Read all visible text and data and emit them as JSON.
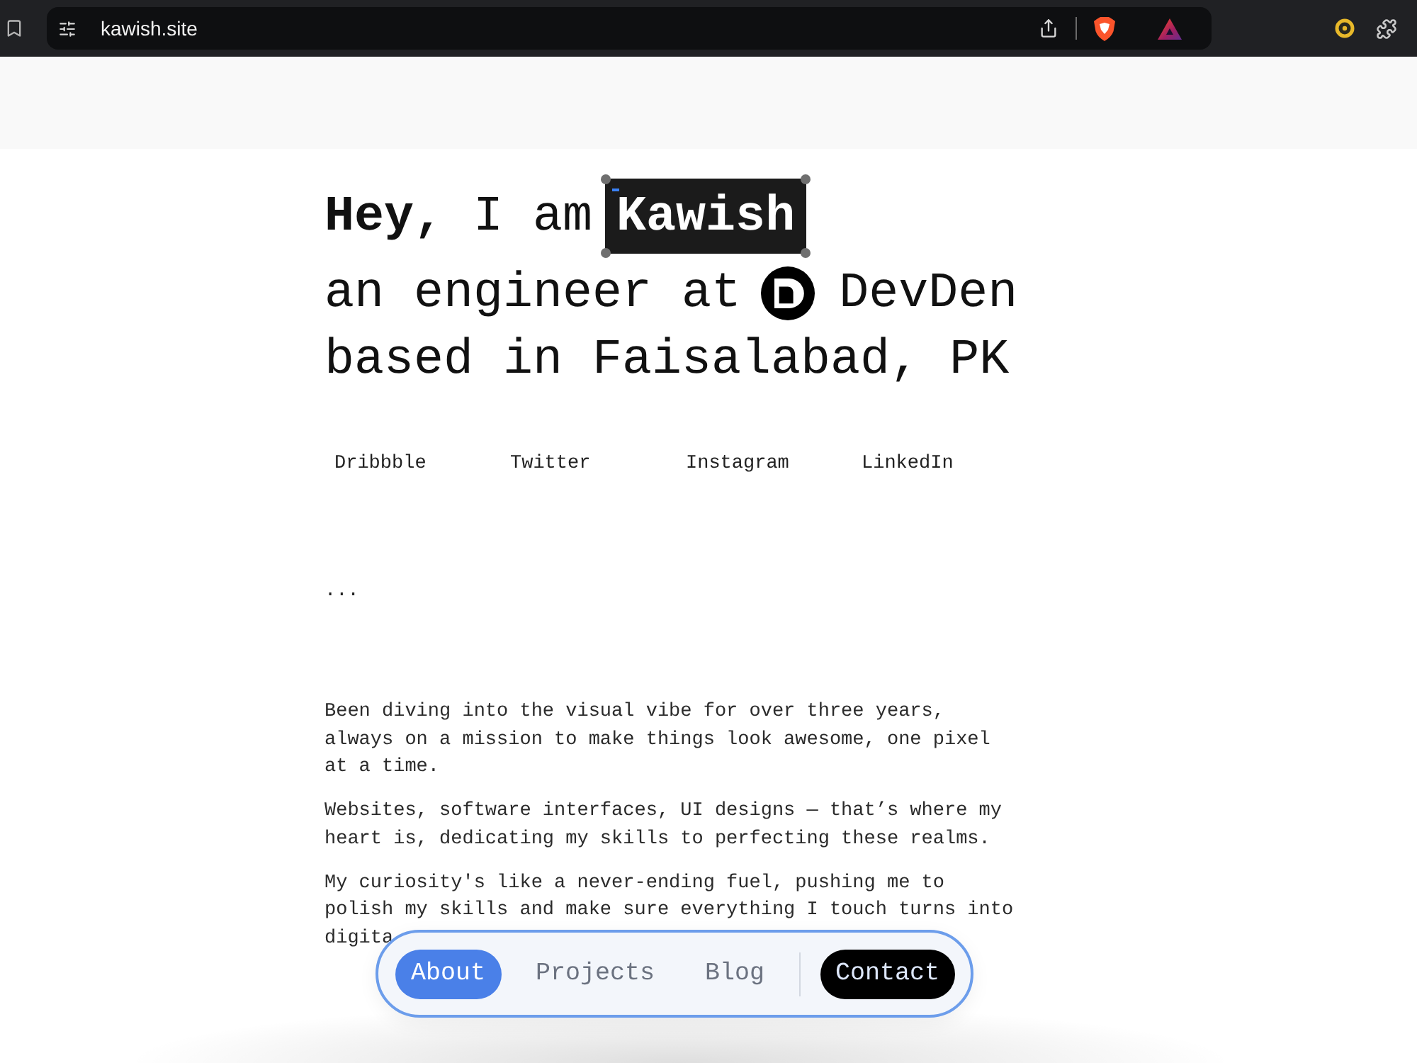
{
  "browser": {
    "url": "kawish.site"
  },
  "hero": {
    "greeting": "**Hey,** I am",
    "name": "Kawish",
    "role": "an engineer at",
    "company": "DevDen",
    "location": "based in Faisalabad, PK"
  },
  "social_links": [
    "Dribbble",
    "Twitter",
    "Instagram",
    "LinkedIn"
  ],
  "ellipsis": "...",
  "paragraphs": [
    "Been diving into the visual vibe for over three years, always on a mission to make things look awesome, one pixel at a time.",
    "Websites, software interfaces, UI designs — that’s where my heart is, dedicating my skills to perfecting these realms.",
    "My curiosity's like a never-ending fuel, pushing me to polish my skills and make sure everything I touch turns into digita"
  ],
  "nav": {
    "items": [
      {
        "label": "About",
        "selected": true
      },
      {
        "label": "Projects",
        "selected": false
      },
      {
        "label": "Blog",
        "selected": false
      }
    ],
    "contact": "Contact"
  }
}
